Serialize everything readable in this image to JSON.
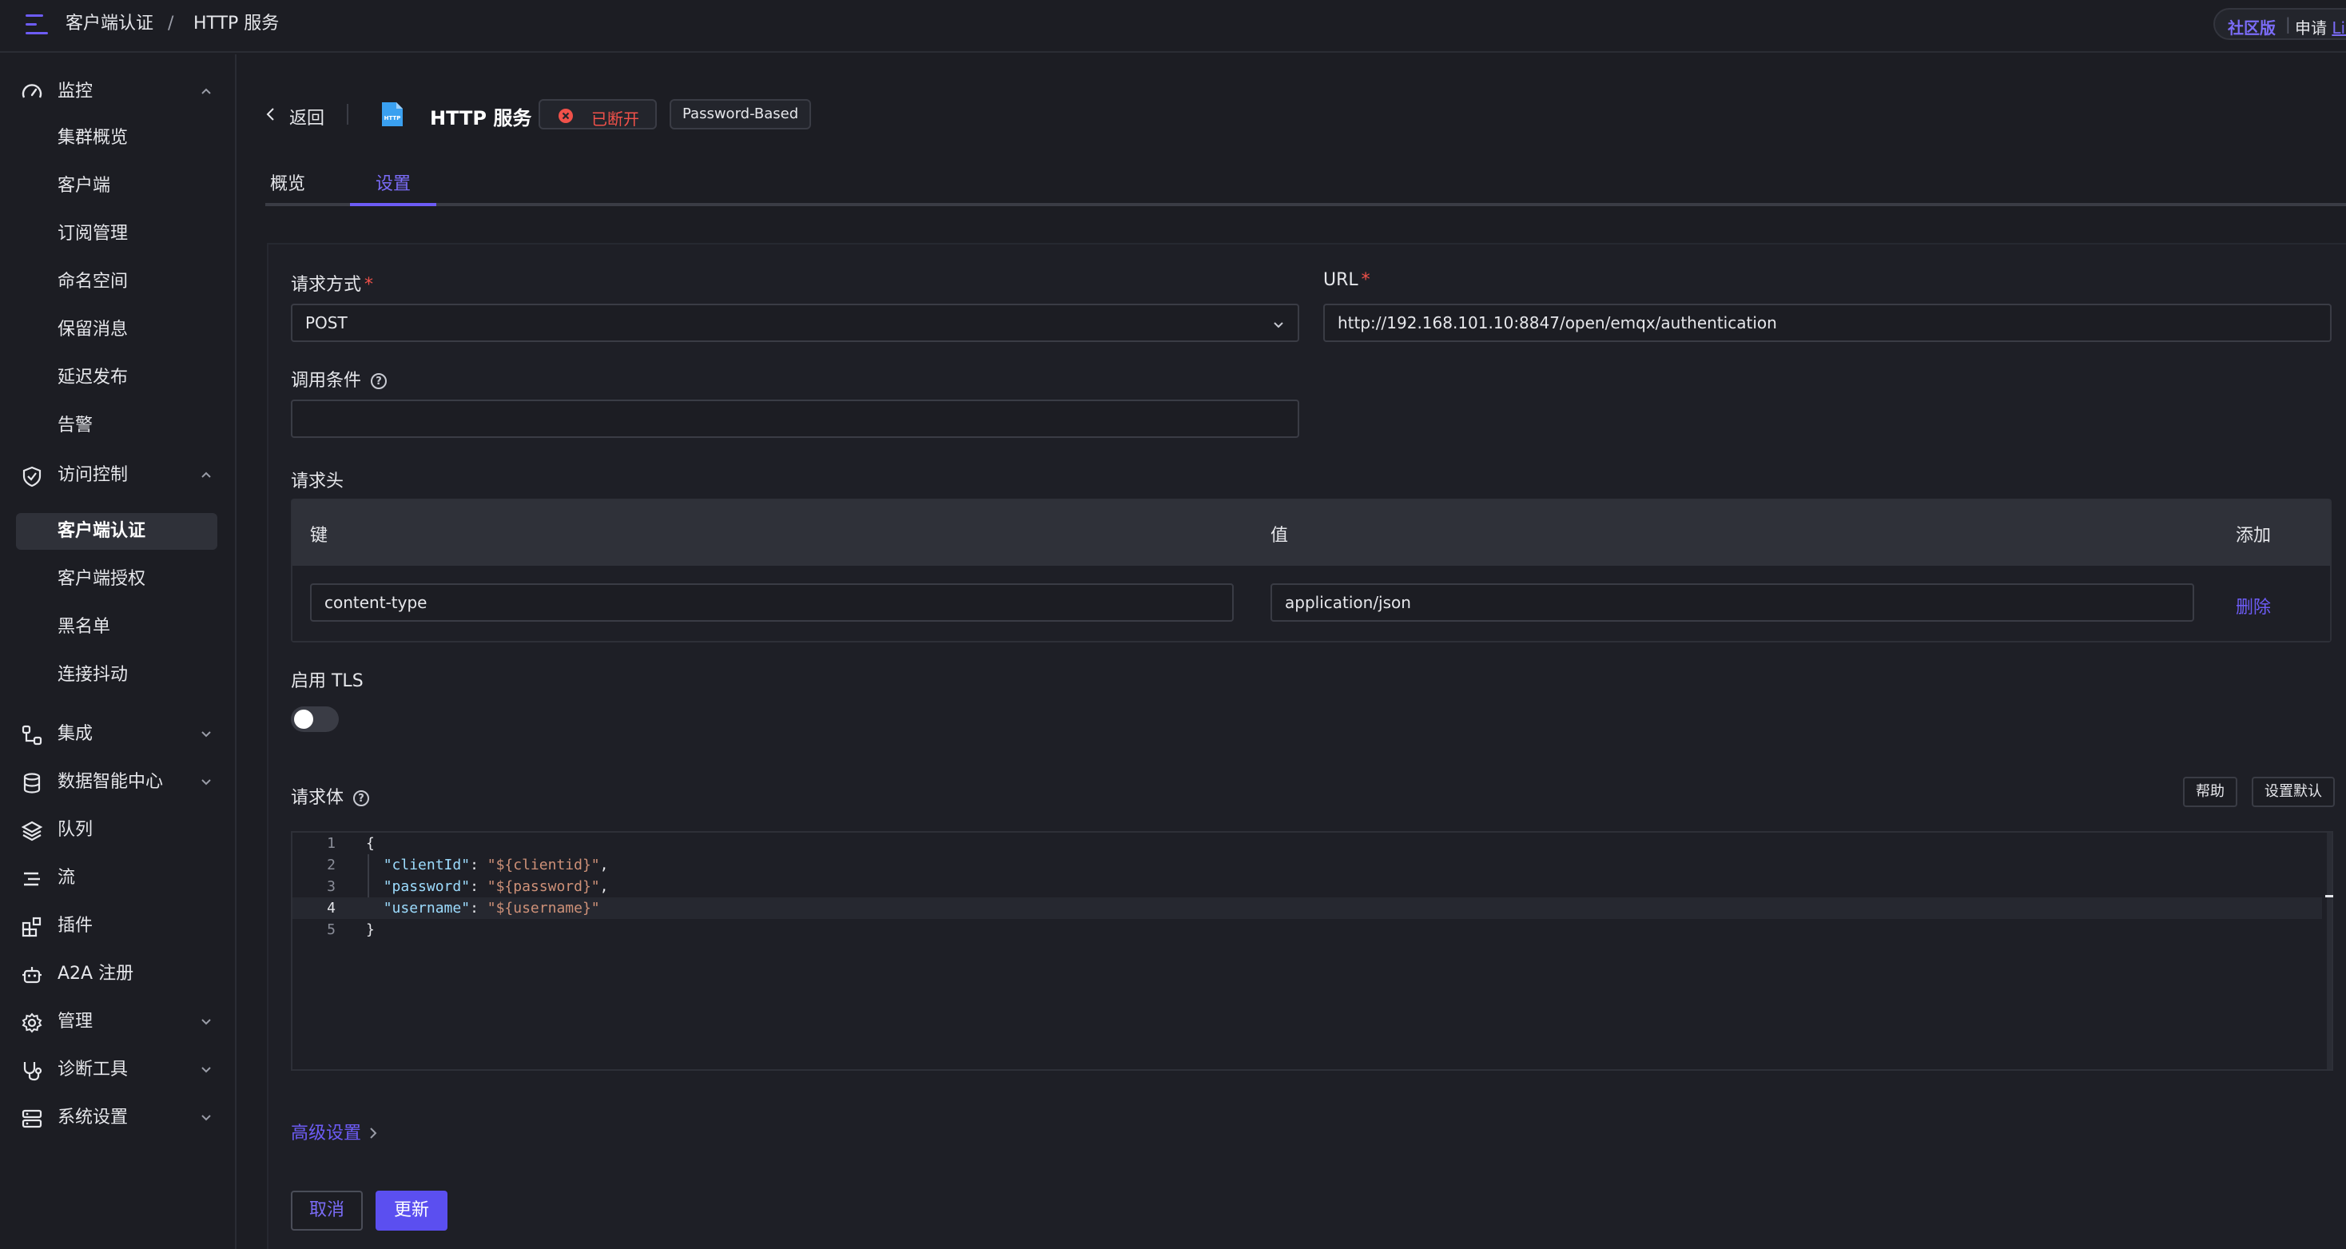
{
  "breadcrumb": {
    "parent": "客户端认证",
    "separator": "/",
    "current": "HTTP 服务"
  },
  "edition": {
    "label": "社区版",
    "separator": "|",
    "apply": "申请",
    "license_link": "Lic"
  },
  "sidebar": {
    "groups": [
      {
        "key": "monitor",
        "label": "监控",
        "icon": "dashboard-gauge-icon",
        "expanded": true,
        "items": [
          "集群概览",
          "客户端",
          "订阅管理",
          "命名空间",
          "保留消息",
          "延迟发布",
          "告警"
        ]
      },
      {
        "key": "access",
        "label": "访问控制",
        "icon": "shield-check-icon",
        "expanded": true,
        "items": [
          "客户端认证",
          "客户端授权",
          "黑名单",
          "连接抖动"
        ],
        "active_item": "客户端认证"
      },
      {
        "key": "integration",
        "label": "集成",
        "icon": "integration-nodes-icon",
        "expanded": false
      },
      {
        "key": "data-center",
        "label": "数据智能中心",
        "icon": "database-icon",
        "expanded": false
      },
      {
        "key": "queue",
        "label": "队列",
        "icon": "layers-icon"
      },
      {
        "key": "flow",
        "label": "流",
        "icon": "flow-lines-icon"
      },
      {
        "key": "plugins",
        "label": "插件",
        "icon": "plugin-blocks-icon"
      },
      {
        "key": "a2a",
        "label": "A2A 注册",
        "icon": "robot-icon"
      },
      {
        "key": "manage",
        "label": "管理",
        "icon": "gear-icon",
        "expanded": false
      },
      {
        "key": "diagnose",
        "label": "诊断工具",
        "icon": "stethoscope-icon",
        "expanded": false
      },
      {
        "key": "system",
        "label": "系统设置",
        "icon": "server-icon",
        "expanded": false
      }
    ]
  },
  "header": {
    "back_label": "返回",
    "logo_icon": "http-file-icon",
    "title": "HTTP 服务",
    "status": "已断开",
    "status_color": "#f0514a",
    "mechanism": "Password-Based"
  },
  "tabs": [
    {
      "label": "概览",
      "active": false
    },
    {
      "label": "设置",
      "active": true
    }
  ],
  "form": {
    "method": {
      "label": "请求方式",
      "required_mark": "*",
      "value": "POST"
    },
    "url": {
      "label": "URL",
      "required_mark": "*",
      "value": "http://192.168.101.10:8847/open/emqx/authentication"
    },
    "condition": {
      "label": "调用条件",
      "help": "?",
      "value": ""
    },
    "headers": {
      "label": "请求头",
      "col_key": "键",
      "col_value": "值",
      "add_label": "添加",
      "rows": [
        {
          "key": "content-type",
          "value": "application/json",
          "delete_label": "删除"
        }
      ]
    },
    "tls": {
      "label": "启用 TLS",
      "enabled": false
    },
    "body": {
      "label": "请求体",
      "help": "?",
      "help_button": "帮助",
      "default_button": "设置默认",
      "lines": [
        "1",
        "2",
        "3",
        "4",
        "5"
      ],
      "code": [
        {
          "pre": "{",
          "key": "",
          "mid": "",
          "val": "",
          "post": ""
        },
        {
          "pre": "  ",
          "key": "\"clientId\"",
          "mid": ": ",
          "val": "\"${clientid}\"",
          "post": ","
        },
        {
          "pre": "  ",
          "key": "\"password\"",
          "mid": ": ",
          "val": "\"${password}\"",
          "post": ","
        },
        {
          "pre": "  ",
          "key": "\"username\"",
          "mid": ": ",
          "val": "\"${username}\"",
          "post": ""
        },
        {
          "pre": "}",
          "key": "",
          "mid": "",
          "val": "",
          "post": ""
        }
      ]
    },
    "advanced_label": "高级设置",
    "cancel_label": "取消",
    "update_label": "更新"
  },
  "colors": {
    "accent": "#6d5cf6",
    "error": "#f0514a",
    "background": "#1c1d23"
  }
}
